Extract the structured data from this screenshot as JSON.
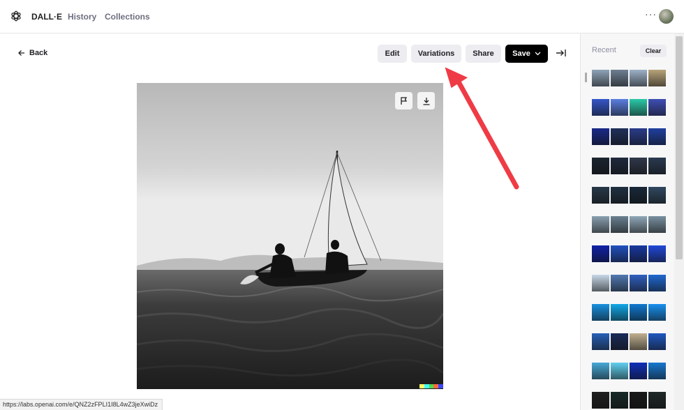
{
  "header": {
    "brand": "DALL·E",
    "nav": [
      "History",
      "Collections"
    ],
    "more_label": "···"
  },
  "toolbar": {
    "back_label": "Back",
    "edit_label": "Edit",
    "variations_label": "Variations",
    "share_label": "Share",
    "save_label": "Save"
  },
  "sidebar": {
    "title": "Recent",
    "clear_label": "Clear"
  },
  "status_url": "https://labs.openai.com/e/QNZ2zFPLI1I8L4wZ3jeXwiDz",
  "colors": {
    "accent_arrow": "#ef3b45",
    "save_bg": "#000000",
    "button_bg": "#ececf1"
  }
}
